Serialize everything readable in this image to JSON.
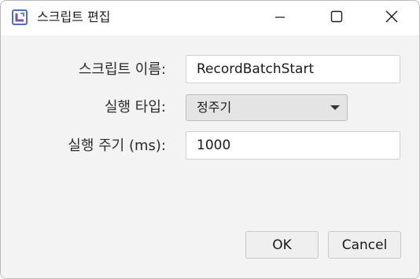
{
  "window": {
    "title": "스크립트 편집",
    "controls": {
      "minimize_icon": "minimize-icon",
      "maximize_icon": "maximize-icon",
      "close_icon": "close-icon"
    }
  },
  "form": {
    "script_name": {
      "label": "스크립트 이름:",
      "value": "RecordBatchStart"
    },
    "run_type": {
      "label": "실행 타입:",
      "selected": "정주기"
    },
    "run_period": {
      "label": "실행 주기 (ms):",
      "value": "1000"
    }
  },
  "buttons": {
    "ok_label": "OK",
    "cancel_label": "Cancel"
  },
  "colors": {
    "window_bg": "#f3f3f3",
    "titlebar_bg": "#ffffff",
    "icon_blue": "#5a7fd6",
    "icon_purple": "#7a4fb0"
  }
}
